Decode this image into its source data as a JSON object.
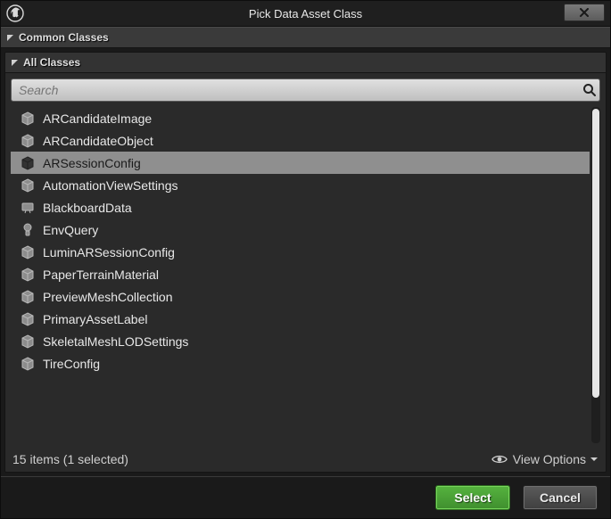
{
  "window": {
    "title": "Pick Data Asset Class"
  },
  "sections": {
    "common": "Common Classes",
    "all": "All Classes"
  },
  "search": {
    "placeholder": "Search",
    "value": ""
  },
  "classes": [
    {
      "name": "ARCandidateImage",
      "icon": "data-asset",
      "selected": false
    },
    {
      "name": "ARCandidateObject",
      "icon": "data-asset",
      "selected": false
    },
    {
      "name": "ARSessionConfig",
      "icon": "data-asset",
      "selected": true
    },
    {
      "name": "AutomationViewSettings",
      "icon": "data-asset",
      "selected": false
    },
    {
      "name": "BlackboardData",
      "icon": "blackboard",
      "selected": false
    },
    {
      "name": "EnvQuery",
      "icon": "blueprint",
      "selected": false
    },
    {
      "name": "LuminARSessionConfig",
      "icon": "data-asset",
      "selected": false
    },
    {
      "name": "PaperTerrainMaterial",
      "icon": "data-asset",
      "selected": false
    },
    {
      "name": "PreviewMeshCollection",
      "icon": "data-asset",
      "selected": false
    },
    {
      "name": "PrimaryAssetLabel",
      "icon": "data-asset",
      "selected": false
    },
    {
      "name": "SkeletalMeshLODSettings",
      "icon": "data-asset",
      "selected": false
    },
    {
      "name": "TireConfig",
      "icon": "data-asset",
      "selected": false
    }
  ],
  "status": {
    "text": "15 items (1 selected)",
    "view_options": "View Options"
  },
  "buttons": {
    "select": "Select",
    "cancel": "Cancel"
  }
}
